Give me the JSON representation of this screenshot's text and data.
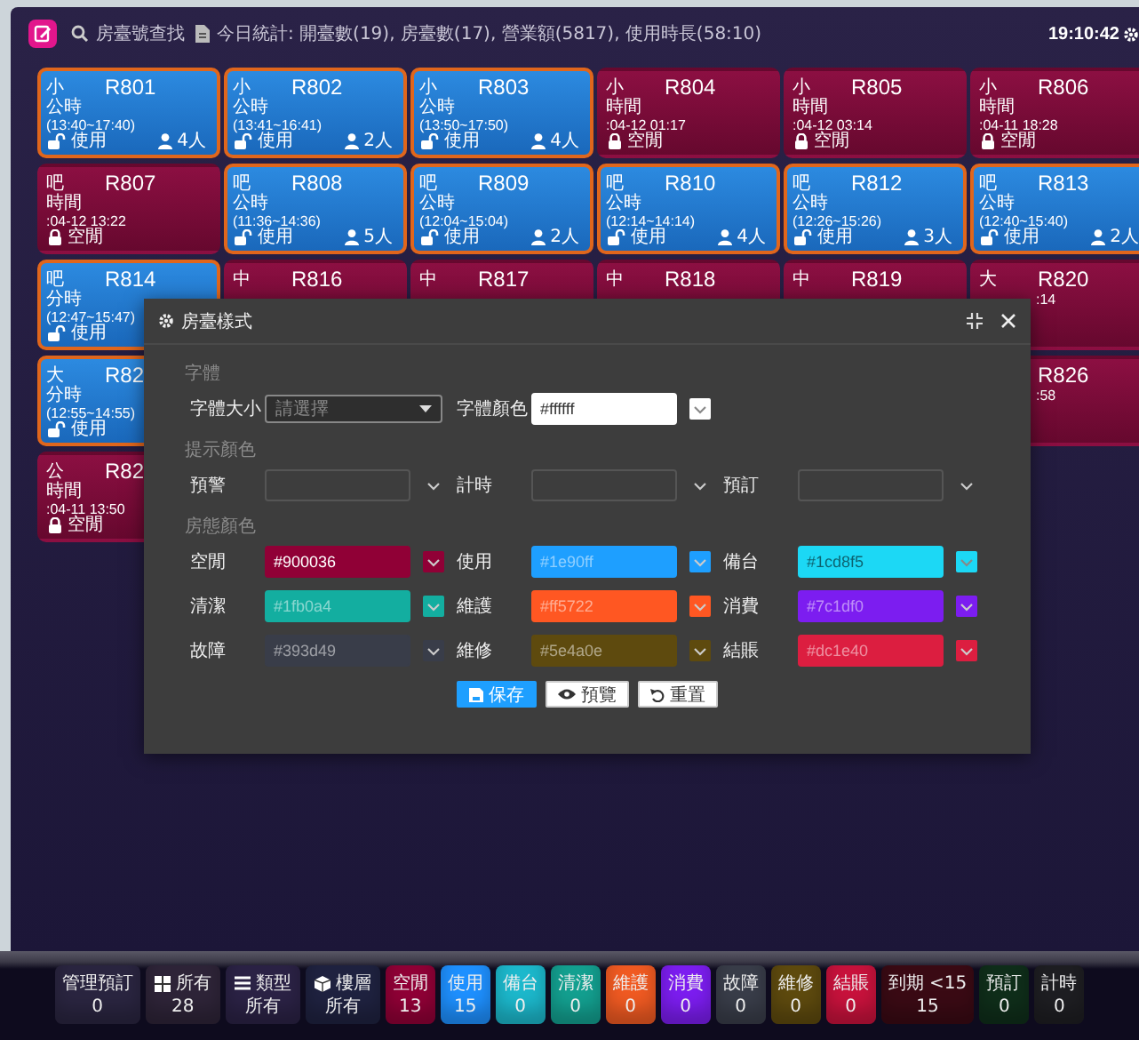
{
  "topbar": {
    "search": "房臺號查找",
    "stats": "今日統計: 開臺數(19), 房臺數(17), 營業額(5817), 使用時長(58:10)",
    "clock": "19:10:42"
  },
  "rooms": [
    [
      {
        "type": "小",
        "room": "R801",
        "kind": "in_use",
        "info": "公時(13:40~17:40)",
        "people": "4人",
        "state": "使用"
      },
      {
        "type": "小",
        "room": "R802",
        "kind": "in_use",
        "info": "公時(13:41~16:41)",
        "people": "2人",
        "state": "使用"
      },
      {
        "type": "小",
        "room": "R803",
        "kind": "in_use",
        "info": "公時(13:50~17:50)",
        "people": "4人",
        "state": "使用"
      },
      {
        "type": "小",
        "room": "R804",
        "kind": "idle",
        "info": "時間:04-12 01:17",
        "state": "空閒"
      },
      {
        "type": "小",
        "room": "R805",
        "kind": "idle",
        "info": "時間:04-12 03:14",
        "state": "空閒"
      },
      {
        "type": "小",
        "room": "R806",
        "kind": "idle",
        "info": "時間:04-11 18:28",
        "state": "空閒"
      }
    ],
    [
      {
        "type": "吧",
        "room": "R807",
        "kind": "idle",
        "info": "時間:04-12 13:22",
        "state": "空閒"
      },
      {
        "type": "吧",
        "room": "R808",
        "kind": "in_use",
        "info": "公時(11:36~14:36)",
        "people": "5人",
        "state": "使用"
      },
      {
        "type": "吧",
        "room": "R809",
        "kind": "in_use",
        "info": "公時(12:04~15:04)",
        "people": "2人",
        "state": "使用"
      },
      {
        "type": "吧",
        "room": "R810",
        "kind": "in_use",
        "info": "公時(12:14~14:14)",
        "people": "4人",
        "state": "使用"
      },
      {
        "type": "吧",
        "room": "R812",
        "kind": "in_use",
        "info": "公時(12:26~15:26)",
        "people": "3人",
        "state": "使用"
      },
      {
        "type": "吧",
        "room": "R813",
        "kind": "in_use",
        "info": "公時(12:40~15:40)",
        "people": "2人",
        "state": "使用"
      }
    ],
    [
      {
        "type": "吧",
        "room": "R814",
        "kind": "in_use",
        "info": "分時(12:47~15:47)",
        "state": "使用"
      },
      {
        "type": "中",
        "room": "R816",
        "kind": "idle"
      },
      {
        "type": "中",
        "room": "R817",
        "kind": "idle"
      },
      {
        "type": "中",
        "room": "R818",
        "kind": "idle"
      },
      {
        "type": "中",
        "room": "R819",
        "kind": "idle"
      },
      {
        "type": "大",
        "room": "R820",
        "kind": "idle",
        "info": ":14",
        "cut": true
      }
    ],
    [
      {
        "type": "大",
        "room": "R82",
        "kind": "in_use",
        "info": "分時(12:55~14:55)",
        "state": "使用"
      },
      {
        "room": "R826",
        "kind": "idle",
        "info": ":58",
        "cut": true
      }
    ],
    [
      {
        "type": "公",
        "room": "R82",
        "kind": "idle",
        "info": "時間:04-11 13:50",
        "state": "空閒"
      }
    ]
  ],
  "dialog": {
    "title": "房臺樣式",
    "sections": [
      {
        "label": "字體",
        "fields": [
          {
            "kind": "select",
            "label": "字體大小",
            "placeholder": "請選擇"
          },
          {
            "kind": "color",
            "label": "字體顏色",
            "value": "#ffffff",
            "color": "#ffffff"
          }
        ]
      },
      {
        "label": "提示顏色",
        "fields": [
          {
            "kind": "color",
            "label": "預警"
          },
          {
            "kind": "color",
            "label": "計時"
          },
          {
            "kind": "color",
            "label": "預訂"
          }
        ]
      },
      {
        "label": "房態顏色",
        "fields": [
          {
            "kind": "color",
            "label": "空閒",
            "value": "#900036",
            "color": "#900036"
          },
          {
            "kind": "color",
            "label": "使用",
            "placeholder": "#1e90ff",
            "color": "#1e9fff"
          },
          {
            "kind": "color",
            "label": "備台",
            "placeholder": "#1cd8f5",
            "color": "#1cd8f5"
          },
          {
            "kind": "color",
            "label": "清潔",
            "placeholder": "#1fb0a4",
            "color": "#13aea0"
          },
          {
            "kind": "color",
            "label": "維護",
            "placeholder": "#ff5722",
            "color": "#ff5722"
          },
          {
            "kind": "color",
            "label": "消費",
            "placeholder": "#7c1df0",
            "color": "#7c1df0"
          },
          {
            "kind": "color",
            "label": "故障",
            "placeholder": "#393d49",
            "color": "#393d49"
          },
          {
            "kind": "color",
            "label": "維修",
            "placeholder": "#5e4a0e",
            "color": "#5e4a0e"
          },
          {
            "kind": "color",
            "label": "結賬",
            "placeholder": "#dc1e40",
            "color": "#dc1e40"
          }
        ]
      }
    ],
    "buttons": [
      {
        "label": "保存",
        "kind": "save"
      },
      {
        "label": "預覽",
        "kind": "preview"
      },
      {
        "label": "重置",
        "kind": "reset"
      }
    ]
  },
  "dock": [
    {
      "label": "管理預訂",
      "count": "0",
      "color": "#2a2540"
    },
    {
      "label": "所有",
      "count": "28",
      "color": "#2e2438"
    },
    {
      "label": "類型",
      "count": "所有",
      "color": "#2b2245"
    },
    {
      "label": "樓層",
      "count": "所有",
      "color": "#1f2240"
    },
    {
      "label": "空閒",
      "count": "13",
      "color": "#900036"
    },
    {
      "label": "使用",
      "count": "15",
      "color": "#1e90ff"
    },
    {
      "label": "備台",
      "count": "0",
      "color": "#1cb8cc"
    },
    {
      "label": "清潔",
      "count": "0",
      "color": "#13a090"
    },
    {
      "label": "維護",
      "count": "0",
      "color": "#f05a22"
    },
    {
      "label": "消費",
      "count": "0",
      "color": "#7c1df0"
    },
    {
      "label": "故障",
      "count": "0",
      "color": "#393d49"
    },
    {
      "label": "維修",
      "count": "0",
      "color": "#5e4a0e"
    },
    {
      "label": "結賬",
      "count": "0",
      "color": "#c8123c"
    },
    {
      "label": "到期 <15",
      "count": "15",
      "color": "#3a0a14"
    },
    {
      "label": "預訂",
      "count": "0",
      "color": "#0f2e1a"
    },
    {
      "label": "計時",
      "count": "0",
      "color": "#1e1e22"
    }
  ]
}
